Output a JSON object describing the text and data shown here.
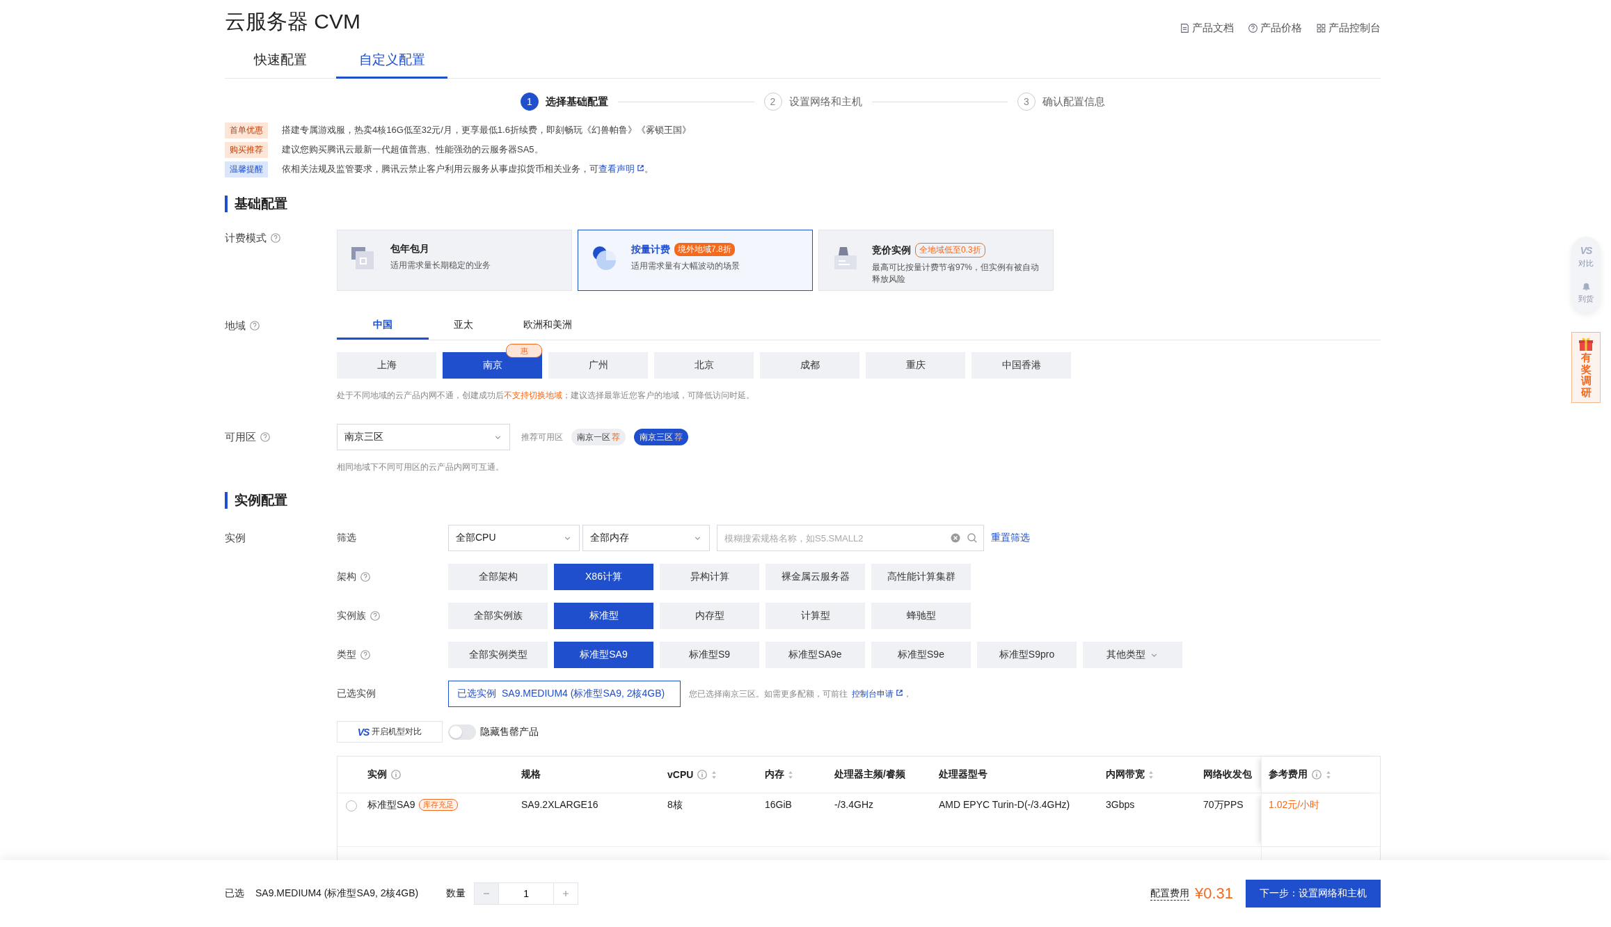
{
  "header": {
    "title": "云服务器 CVM",
    "links": [
      {
        "label": "产品文档"
      },
      {
        "label": "产品价格"
      },
      {
        "label": "产品控制台"
      }
    ]
  },
  "mode_tabs": [
    {
      "label": "快速配置",
      "selected": false
    },
    {
      "label": "自定义配置",
      "selected": true
    }
  ],
  "steps": [
    {
      "number": "1",
      "label": "选择基础配置",
      "selected": true
    },
    {
      "number": "2",
      "label": "设置网络和主机",
      "selected": false
    },
    {
      "number": "3",
      "label": "确认配置信息",
      "selected": false
    }
  ],
  "notices": [
    {
      "tag": "首单优惠",
      "kind": "promo",
      "text": "搭建专属游戏服，热卖4核16G低至32元/月，更享最低1.6折续费，即刻畅玩《幻兽帕鲁》《雾锁王国》"
    },
    {
      "tag": "购买推荐",
      "kind": "promo",
      "text": "建议您购买腾讯云最新一代超值普惠、性能强劲的云服务器SA5。"
    },
    {
      "tag": "温馨提醒",
      "kind": "info",
      "text": "依相关法规及监管要求，腾讯云禁止客户利用云服务从事虚拟货币相关业务，可",
      "link": "查看声明",
      "text_after": "。"
    }
  ],
  "basic_config": {
    "title": "基础配置",
    "billing": {
      "label": "计费模式",
      "options": [
        {
          "kind": "plain",
          "title": "包年包月",
          "desc": "适用需求量长期稳定的业务",
          "selected": false
        },
        {
          "kind": "filled_badge",
          "title": "按量计费",
          "badge": "境外地域7.8折",
          "desc": "适用需求量有大幅波动的场景",
          "selected": true
        },
        {
          "kind": "outline_badge",
          "title": "竞价实例",
          "badge": "全地域低至0.3折",
          "desc": "最高可比按量计费节省97%，但实例有被自动释放风险",
          "selected": false
        }
      ]
    },
    "region": {
      "label": "地域",
      "tabs": [
        {
          "label": "中国",
          "selected": true
        },
        {
          "label": "亚太",
          "selected": false
        },
        {
          "label": "欧洲和美洲",
          "selected": false
        }
      ],
      "options": [
        {
          "name": "上海",
          "selected": false
        },
        {
          "name": "南京",
          "selected": true,
          "badge": "惠"
        },
        {
          "name": "广州",
          "selected": false
        },
        {
          "name": "北京",
          "selected": false
        },
        {
          "name": "成都",
          "selected": false
        },
        {
          "name": "重庆",
          "selected": false
        },
        {
          "name": "中国香港",
          "selected": false
        }
      ],
      "hint": [
        {
          "text": "处于不同地域的云产品内网不通，创建成功后",
          "highlight": false
        },
        {
          "text": "不支持切换地域",
          "highlight": true
        },
        {
          "text": "；建议选择最靠近您客户的地域，可降低访问时延。",
          "highlight": false
        }
      ]
    },
    "zone": {
      "label": "可用区",
      "value": "南京三区",
      "recommend_label": "推荐可用区",
      "chips": [
        {
          "name": "南京一区",
          "mark": "荐",
          "selected": false
        },
        {
          "name": "南京三区",
          "mark": "荐",
          "selected": true
        }
      ],
      "hint": "相同地域下不同可用区的云产品内网可互通。"
    }
  },
  "instance_config": {
    "title": "实例配置",
    "label": "实例",
    "filter": {
      "label": "筛选",
      "cpu": "全部CPU",
      "memory": "全部内存",
      "search_placeholder": "模糊搜索规格名称，如S5.SMALL2",
      "reset": "重置筛选"
    },
    "option_rows": [
      {
        "label": "架构",
        "options": [
          {
            "name": "全部架构",
            "selected": false,
            "kind": "option"
          },
          {
            "name": "X86计算",
            "selected": true,
            "kind": "option"
          },
          {
            "name": "异构计算",
            "selected": false,
            "kind": "option"
          },
          {
            "name": "裸金属云服务器",
            "selected": false,
            "kind": "option"
          },
          {
            "name": "高性能计算集群",
            "selected": false,
            "kind": "option"
          }
        ]
      },
      {
        "label": "实例族",
        "options": [
          {
            "name": "全部实例族",
            "selected": false,
            "kind": "option"
          },
          {
            "name": "标准型",
            "selected": true,
            "kind": "option"
          },
          {
            "name": "内存型",
            "selected": false,
            "kind": "option"
          },
          {
            "name": "计算型",
            "selected": false,
            "kind": "option"
          },
          {
            "name": "蜂驰型",
            "selected": false,
            "kind": "option"
          }
        ]
      },
      {
        "label": "类型",
        "options": [
          {
            "name": "全部实例类型",
            "selected": false,
            "kind": "option"
          },
          {
            "name": "标准型SA9",
            "selected": true,
            "kind": "option"
          },
          {
            "name": "标准型S9",
            "selected": false,
            "kind": "option"
          },
          {
            "name": "标准型SA9e",
            "selected": false,
            "kind": "option"
          },
          {
            "name": "标准型S9e",
            "selected": false,
            "kind": "option"
          },
          {
            "name": "标准型S9pro",
            "selected": false,
            "kind": "option"
          },
          {
            "name": "其他类型",
            "selected": false,
            "kind": "dropdown"
          }
        ]
      }
    ],
    "selected_instance": {
      "label": "已选实例",
      "box_label": "已选实例",
      "value": "SA9.MEDIUM4 (标准型SA9, 2核4GB)",
      "note": "您已选择南京三区。如需更多配额，可前往",
      "link": "控制台申请",
      "note_after": "，"
    },
    "compare_button": {
      "mark": "VS",
      "label": "开启机型对比"
    },
    "hide_sold_out": {
      "label": "隐藏售罄产品",
      "on": false
    },
    "table": {
      "columns": [
        {
          "label": "实例",
          "info": true,
          "sortable": false
        },
        {
          "label": "规格",
          "info": false,
          "sortable": false
        },
        {
          "label": "vCPU",
          "info": true,
          "sortable": true
        },
        {
          "label": "内存",
          "info": false,
          "sortable": true
        },
        {
          "label": "处理器主频/睿频",
          "info": false,
          "sortable": false
        },
        {
          "label": "处理器型号",
          "info": false,
          "sortable": false
        },
        {
          "label": "内网带宽",
          "info": false,
          "sortable": true
        },
        {
          "label": "网络收发包",
          "info": false,
          "sortable": false
        },
        {
          "label": "参考费用",
          "info": true,
          "sortable": true
        }
      ],
      "rows": [
        {
          "selected": false,
          "stock": "库存充足",
          "cells": [
            "标准型SA9",
            "SA9.2XLARGE16",
            "8核",
            "16GiB",
            "-/3.4GHz",
            "AMD EPYC Turin-D(-/3.4GHz)",
            "3Gbps",
            "70万PPS",
            "1.02元/小时"
          ]
        }
      ]
    }
  },
  "bottom_bar": {
    "selected_label": "已选",
    "selected_value": "SA9.MEDIUM4 (标准型SA9, 2核4GB)",
    "quantity_label": "数量",
    "quantity": "1",
    "fee_label": "配置费用",
    "fee": "¥0.31",
    "next_button": "下一步：设置网络和主机"
  },
  "side_tools": {
    "items": [
      {
        "label": "对比",
        "mark": "VS"
      },
      {
        "label": "到货"
      }
    ],
    "survey": "有奖调研"
  }
}
